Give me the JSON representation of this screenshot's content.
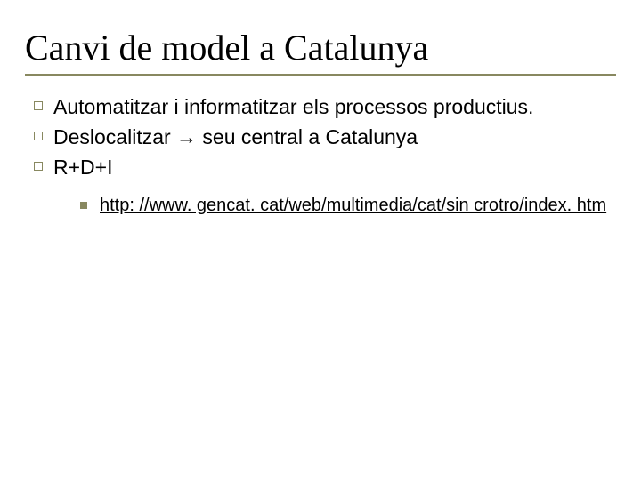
{
  "title": "Canvi de model a Catalunya",
  "bullets": [
    "Automatitzar i informatitzar els processos productius.",
    "Deslocalitzar → seu central a Catalunya",
    "R+D+I"
  ],
  "sub": {
    "link_text": "http: //www. gencat. cat/web/multimedia/cat/sin crotro/index. htm",
    "link_href": "http://www.gencat.cat/web/multimedia/cat/sincrotro/index.htm"
  }
}
